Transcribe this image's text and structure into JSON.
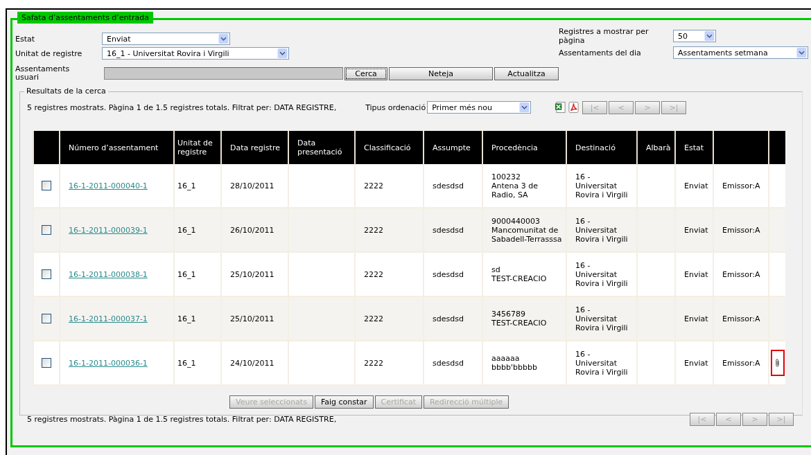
{
  "panel": {
    "title": "Safata d’assentaments d’entrada"
  },
  "filters": {
    "estat": {
      "label": "Estat",
      "value": "Enviat"
    },
    "unitat": {
      "label": "Unitat de registre",
      "value": "16_1 - Universitat Rovira i Virgili"
    },
    "usuari": {
      "label": "Assentaments usuari",
      "disabled": true
    },
    "per_page": {
      "label": "Registres a mostrar per pàgina",
      "value": "50"
    },
    "dia": {
      "label": "Assentaments del dia",
      "value": "Assentaments setmana"
    }
  },
  "search_buttons": [
    {
      "label": "Cerca",
      "focused": true
    },
    {
      "label": "Neteja",
      "focused": false
    },
    {
      "label": "Actualitza",
      "focused": false
    }
  ],
  "results": {
    "title": "Resultats de la cerca",
    "summary": "5 registres mostrats. Pàgina 1 de 1.5 registres totals. Filtrat per: DATA REGISTRE,",
    "sort": {
      "label": "Tipus ordenació",
      "value": "Primer més nou"
    },
    "pager": [
      {
        "label": "|<",
        "disabled": true
      },
      {
        "label": "<",
        "disabled": true
      },
      {
        "label": ">",
        "disabled": true
      },
      {
        "label": ">|",
        "disabled": true
      }
    ],
    "columns": [
      "Número d’assentament",
      "Unitat de registre",
      "Data registre",
      "Data presentació",
      "Classificació",
      "Assumpte",
      "Procedència",
      "Destinació",
      "Albarà",
      "Estat"
    ],
    "rows": [
      {
        "checked": false,
        "number": "16-1-2011-000040-1",
        "unitat": "16_1",
        "data_registre": "28/10/2011",
        "classificacio": "2222",
        "assumpte": "sdesdsd",
        "procedencia": [
          "100232",
          "Antena 3 de Radio, SA"
        ],
        "destinacio": "16 - Universitat Rovira i Virgili",
        "estat": "Enviat",
        "emissor": "Emissor:A",
        "attachment": false,
        "highlighted": false
      },
      {
        "checked": false,
        "number": "16-1-2011-000039-1",
        "unitat": "16_1",
        "data_registre": "26/10/2011",
        "classificacio": "2222",
        "assumpte": "sdesdsd",
        "procedencia": [
          "9000440003",
          "Mancomunitat de Sabadell-Terrasssa"
        ],
        "destinacio": "16 - Universitat Rovira i Virgili",
        "estat": "Enviat",
        "emissor": "Emissor:A",
        "attachment": false,
        "highlighted": false
      },
      {
        "checked": false,
        "number": "16-1-2011-000038-1",
        "unitat": "16_1",
        "data_registre": "25/10/2011",
        "classificacio": "2222",
        "assumpte": "sdesdsd",
        "procedencia": [
          "sd",
          "TEST-CREACIO"
        ],
        "destinacio": "16 - Universitat Rovira i Virgili",
        "estat": "Enviat",
        "emissor": "Emissor:A",
        "attachment": false,
        "highlighted": false
      },
      {
        "checked": false,
        "number": "16-1-2011-000037-1",
        "unitat": "16_1",
        "data_registre": "25/10/2011",
        "classificacio": "2222",
        "assumpte": "sdesdsd",
        "procedencia": [
          "3456789",
          "TEST-CREACIO"
        ],
        "destinacio": "16 - Universitat Rovira i Virgili",
        "estat": "Enviat",
        "emissor": "Emissor:A",
        "attachment": false,
        "highlighted": false
      },
      {
        "checked": false,
        "number": "16-1-2011-000036-1",
        "unitat": "16_1",
        "data_registre": "24/10/2011",
        "classificacio": "2222",
        "assumpte": "sdesdsd",
        "procedencia": [
          "aaaaaa",
          "bbbb'bbbbb"
        ],
        "destinacio": "16 - Universitat Rovira i Virgili",
        "estat": "Enviat",
        "emissor": "Emissor:A",
        "attachment": true,
        "highlighted": true
      }
    ],
    "actions": [
      {
        "label": "Veure seleccionats",
        "disabled": true
      },
      {
        "label": "Faig constar",
        "disabled": false
      },
      {
        "label": "Certificat",
        "disabled": true
      },
      {
        "label": "Redirecció múltiple",
        "disabled": true
      }
    ],
    "footer_summary": "5 registres mostrats. Pàgina 1 de 1.5 registres totals. Filtrat per: DATA REGISTRE,",
    "footer_pager": [
      {
        "label": "|<",
        "disabled": true
      },
      {
        "label": "<",
        "disabled": true
      },
      {
        "label": ">",
        "disabled": true
      },
      {
        "label": ">|",
        "disabled": true
      }
    ]
  }
}
